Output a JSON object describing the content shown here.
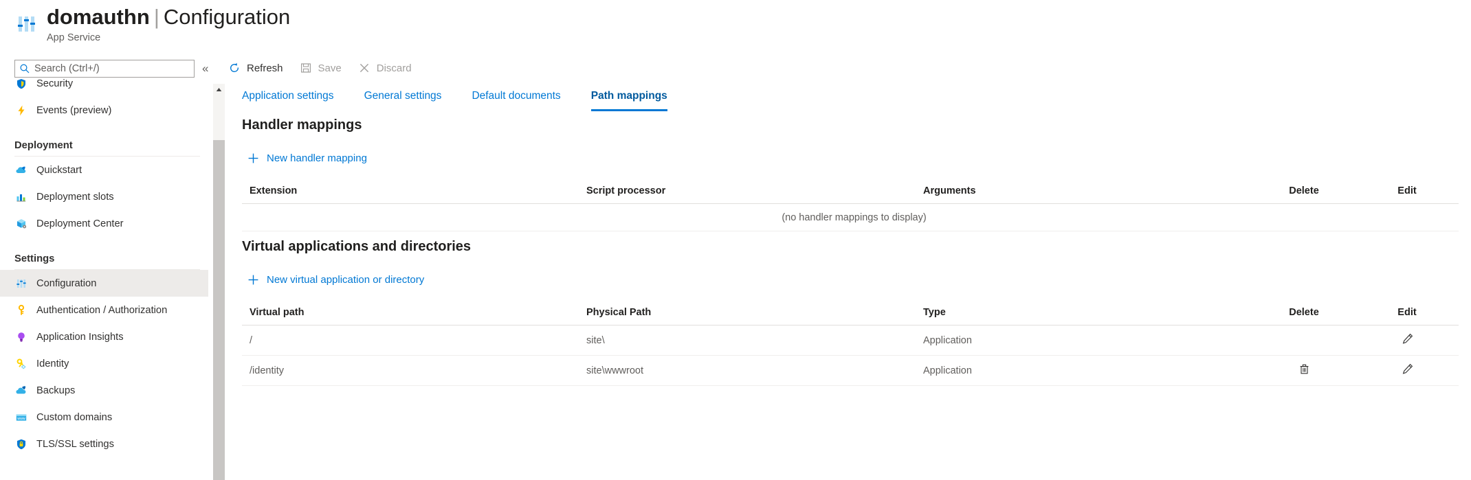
{
  "header": {
    "resource_name": "domauthn",
    "separator": "|",
    "page_name": "Configuration",
    "resource_type": "App Service",
    "icon": "configuration-sliders-icon"
  },
  "sidebar": {
    "search": {
      "placeholder": "Search (Ctrl+/)",
      "value": "",
      "icon": "search-icon"
    },
    "collapse_label": "«",
    "items": [
      {
        "label": "Security",
        "icon": "shield-icon",
        "selected": false,
        "clipped": true
      },
      {
        "label": "Events (preview)",
        "icon": "lightning-icon",
        "selected": false
      },
      {
        "label": "Deployment",
        "type": "group"
      },
      {
        "label": "Quickstart",
        "icon": "cloud-rocket-icon",
        "selected": false
      },
      {
        "label": "Deployment slots",
        "icon": "chart-bars-icon",
        "selected": false
      },
      {
        "label": "Deployment Center",
        "icon": "package-box-icon",
        "selected": false
      },
      {
        "label": "Settings",
        "type": "group"
      },
      {
        "label": "Configuration",
        "icon": "sliders-icon",
        "selected": true
      },
      {
        "label": "Authentication / Authorization",
        "icon": "key-icon",
        "selected": false
      },
      {
        "label": "Application Insights",
        "icon": "lightbulb-icon",
        "selected": false
      },
      {
        "label": "Identity",
        "icon": "key-badge-icon",
        "selected": false
      },
      {
        "label": "Backups",
        "icon": "cloud-backup-icon",
        "selected": false
      },
      {
        "label": "Custom domains",
        "icon": "www-window-icon",
        "selected": false
      },
      {
        "label": "TLS/SSL settings",
        "icon": "lock-shield-icon",
        "selected": false
      }
    ]
  },
  "commandbar": {
    "buttons": [
      {
        "label": "Refresh",
        "icon": "refresh-icon",
        "disabled": false
      },
      {
        "label": "Save",
        "icon": "save-disk-icon",
        "disabled": true
      },
      {
        "label": "Discard",
        "icon": "close-x-icon",
        "disabled": true
      }
    ]
  },
  "tabs": [
    {
      "label": "Application settings",
      "active": false
    },
    {
      "label": "General settings",
      "active": false
    },
    {
      "label": "Default documents",
      "active": false
    },
    {
      "label": "Path mappings",
      "active": true
    }
  ],
  "handler_mappings": {
    "title": "Handler mappings",
    "add_label": "New handler mapping",
    "columns": [
      "Extension",
      "Script processor",
      "Arguments",
      "Delete",
      "Edit"
    ],
    "rows": [],
    "empty_text": "(no handler mappings to display)"
  },
  "virtual_applications": {
    "title": "Virtual applications and directories",
    "add_label": "New virtual application or directory",
    "columns": [
      "Virtual path",
      "Physical Path",
      "Type",
      "Delete",
      "Edit"
    ],
    "rows": [
      {
        "virtual_path": "/",
        "physical_path": "site\\",
        "type": "Application",
        "delete_icon": null,
        "edit_icon": "pencil-icon"
      },
      {
        "virtual_path": "/identity",
        "physical_path": "site\\wwwroot",
        "type": "Application",
        "delete_icon": "trash-icon",
        "edit_icon": "pencil-icon"
      }
    ]
  },
  "colors": {
    "accent": "#0078d4",
    "accent_dark": "#005a9e",
    "text": "#201f1e",
    "muted": "#605e5c",
    "selected_bg": "#edebe9"
  }
}
